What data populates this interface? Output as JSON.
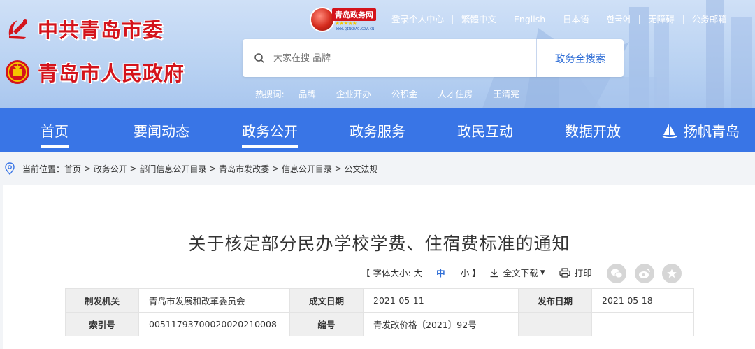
{
  "header": {
    "org1": "中共青岛市委",
    "org2": "青岛市人民政府",
    "portal_name": "青岛政务网",
    "portal_url": "WWW.QINGDAO.GOV.CN",
    "top_links": [
      "登录个人中心",
      "繁體中文",
      "English",
      "日本语",
      "한국어",
      "无障碍",
      "公务邮箱"
    ],
    "search": {
      "placeholder": "大家在搜 品牌",
      "button": "政务全搜索"
    },
    "hot_label": "热搜词:",
    "hot_words": [
      "品牌",
      "企业开办",
      "公积金",
      "人才住房",
      "王清宪"
    ]
  },
  "nav": {
    "items": [
      "首页",
      "要闻动态",
      "政务公开",
      "政务服务",
      "政民互动",
      "数据开放",
      "扬帆青岛"
    ],
    "active": [
      "首页",
      "政务公开"
    ]
  },
  "breadcrumb": {
    "label": "当前位置：",
    "items": [
      "首页",
      "政务公开",
      "部门信息公开目录",
      "青岛市发改委",
      "信息公开目录",
      "公文法规"
    ]
  },
  "article": {
    "title": "关于核定部分民办学校学费、住宿费标准的通知",
    "font_size_label": "【 字体大小: 大",
    "font_mid": "中",
    "font_small": "小 】",
    "download": "全文下载",
    "print": "打印"
  },
  "meta_table": {
    "rows": [
      [
        {
          "k": "制发机关"
        },
        {
          "v": "青岛市发展和改革委员会"
        },
        {
          "k": "成文日期"
        },
        {
          "v": "2021-05-11"
        },
        {
          "k": "发布日期"
        },
        {
          "v": "2021-05-18"
        }
      ],
      [
        {
          "k": "索引号"
        },
        {
          "v": "00511793700020020210008"
        },
        {
          "k": "编号"
        },
        {
          "v": "青发改价格〔2021〕92号"
        },
        {
          "k": ""
        },
        {
          "v": ""
        }
      ]
    ]
  },
  "colors": {
    "nav_bg": "#3975e6",
    "accent": "#2f6ed6",
    "logo_red": "#d4141c"
  }
}
